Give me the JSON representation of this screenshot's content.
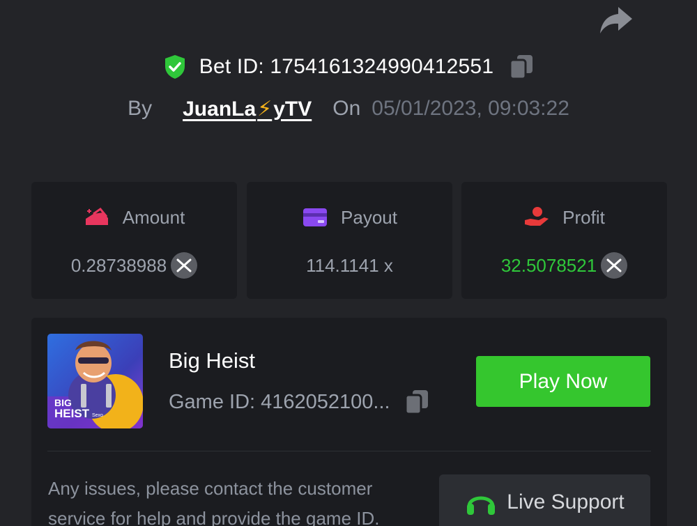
{
  "header": {
    "share_icon": "share-arrow-icon",
    "verified_icon": "shield-check-icon",
    "bet_id_label": "Bet ID: 175416132499041255​1",
    "by_label": "By",
    "username_part1": "JuanLa",
    "username_bolt": "⚡",
    "username_part2": "yTV",
    "on_label": "On",
    "date": "05/01/2023, 09:03:22"
  },
  "stats": [
    {
      "label": "Amount",
      "value": "0.28738988",
      "icon": "wallet-plus-icon",
      "has_coin": true,
      "value_color": "#9da3ae"
    },
    {
      "label": "Payout",
      "value": "114.1141 x",
      "icon": "card-icon",
      "has_coin": false,
      "value_color": "#9da3ae"
    },
    {
      "label": "Profit",
      "value": "32.5078521",
      "icon": "hand-profit-icon",
      "has_coin": true,
      "value_color": "#2fc73a"
    }
  ],
  "game": {
    "thumbnail_text_line1": "BIG",
    "thumbnail_text_line2": "HEIST",
    "thumbnail_brand": "Sexo",
    "title": "Big Heist",
    "game_id": "Game ID: 4162052100...",
    "play_button": "Play Now",
    "help_text": "Any issues, please contact the customer service for help and provide the game ID.",
    "live_support": "Live Support"
  },
  "colors": {
    "background": "#232428",
    "card": "#1b1c20",
    "accent_green": "#35c62e",
    "profit_green": "#2fc73a",
    "muted_text": "#9da3ae"
  }
}
